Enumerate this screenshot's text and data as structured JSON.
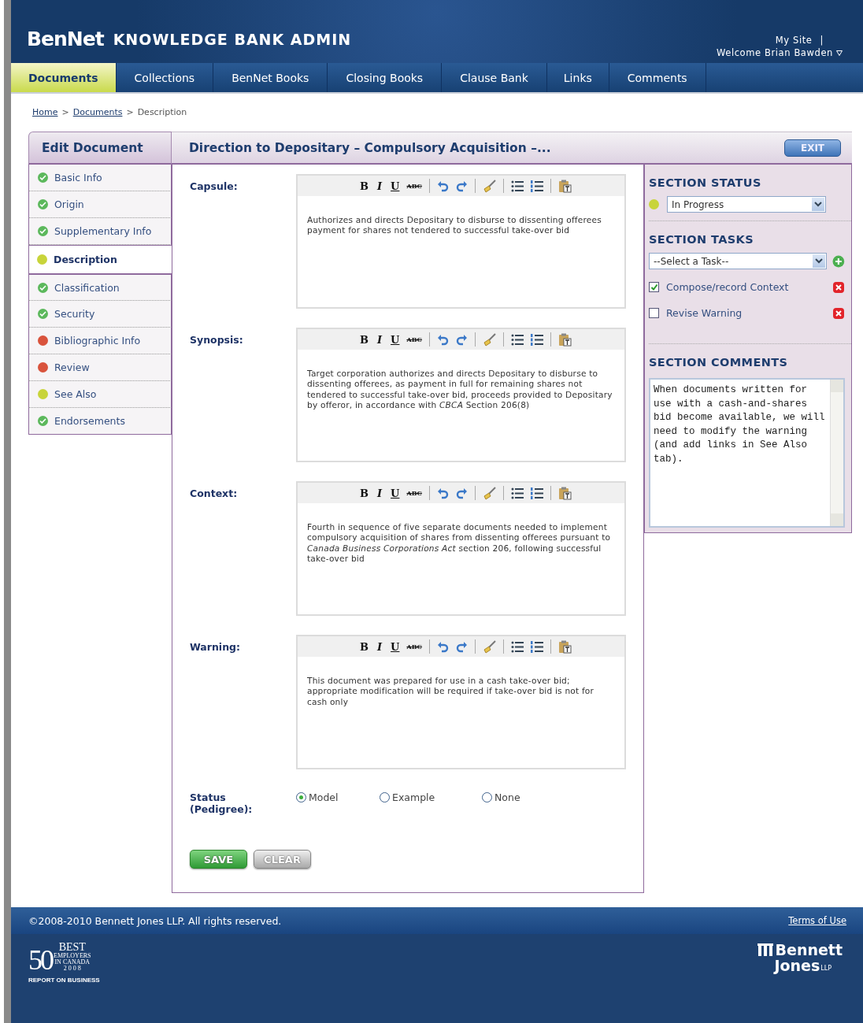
{
  "header": {
    "logo": "BenNet",
    "title": "KNOWLEDGE BANK ADMIN",
    "my_site": "My Site",
    "separator": "|",
    "welcome": "Welcome Brian Bawden"
  },
  "nav": [
    {
      "label": "Documents",
      "selected": true
    },
    {
      "label": "Collections",
      "selected": false
    },
    {
      "label": "BenNet Books",
      "selected": false
    },
    {
      "label": "Closing Books",
      "selected": false
    },
    {
      "label": "Clause Bank",
      "selected": false
    },
    {
      "label": "Links",
      "selected": false
    },
    {
      "label": "Comments",
      "selected": false
    }
  ],
  "breadcrumb": [
    {
      "label": "Home",
      "link": true
    },
    {
      "label": "Documents",
      "link": true
    },
    {
      "label": "Description",
      "link": false
    }
  ],
  "breadcrumb_separators": [
    ">",
    ">"
  ],
  "sidebar": {
    "title": "Edit Document",
    "items": [
      {
        "label": "Basic Info",
        "kind": "done",
        "color": "#5cb85c",
        "selected": false
      },
      {
        "label": "Origin",
        "kind": "done",
        "color": "#5cb85c",
        "selected": false
      },
      {
        "label": "Supplementary Info",
        "kind": "done",
        "color": "#5cb85c",
        "selected": false
      },
      {
        "label": "Description",
        "kind": "dot",
        "color": "#c8d43a",
        "selected": true
      },
      {
        "label": "Classification",
        "kind": "done",
        "color": "#5cb85c",
        "selected": false
      },
      {
        "label": "Security",
        "kind": "done",
        "color": "#5cb85c",
        "selected": false
      },
      {
        "label": "Bibliographic Info",
        "kind": "dot",
        "color": "#d9533c",
        "selected": false
      },
      {
        "label": "Review",
        "kind": "dot",
        "color": "#d9533c",
        "selected": false
      },
      {
        "label": "See Also",
        "kind": "dot",
        "color": "#c8d43a",
        "selected": false
      },
      {
        "label": "Endorsements",
        "kind": "done",
        "color": "#5cb85c",
        "selected": false
      }
    ]
  },
  "document": {
    "title": "Direction to Depositary – Compulsory Acquisition –...",
    "exit_button": "EXIT"
  },
  "fields": [
    {
      "label": "Capsule:",
      "toolbar": [
        "B",
        "I",
        "U",
        "ABC"
      ],
      "text": "Authorizes and directs Depositary to disburse to dissenting offerees payment for shares not tendered to successful take-over bid"
    },
    {
      "label": "Synopsis:",
      "toolbar": [
        "B",
        "I",
        "U",
        "ABC"
      ],
      "text": "Target corporation authorizes and directs Depositary to disburse to dissenting offerees, as payment in full for remaining shares not tendered to successful take-over bid, proceeds provided to Depositary by offeror, in accordance with *CBCA* Section 206(8)"
    },
    {
      "label": "Context:",
      "toolbar": [
        "B",
        "I",
        "U",
        "ABC"
      ],
      "text": "Fourth in sequence of five separate documents needed to implement compulsory acquisition of shares from dissenting offerees pursuant to *Canada Business Corporations Act* section 206, following successful take-over bid"
    },
    {
      "label": "Warning:",
      "toolbar": [
        "B",
        "I",
        "U",
        "ABC"
      ],
      "text": "This document was prepared for use in a cash take-over bid; appropriate modification will be required if take-over bid is not for cash only"
    }
  ],
  "pedigree": {
    "label_lines": [
      "Status",
      "(Pedigree):"
    ],
    "options": [
      {
        "label": "Model",
        "selected": true
      },
      {
        "label": "Example",
        "selected": false
      },
      {
        "label": "None",
        "selected": false
      }
    ]
  },
  "buttons": {
    "save": "SAVE",
    "clear": "CLEAR"
  },
  "section_status": {
    "heading": "SECTION STATUS",
    "kind": "dot",
    "color": "#c8d43a",
    "value": "In Progress"
  },
  "section_tasks": {
    "heading": "SECTION TASKS",
    "placeholder": "--Select a Task--",
    "items": [
      {
        "label": "Compose/record Context",
        "checked": true
      },
      {
        "label": "Revise Warning",
        "checked": false
      }
    ]
  },
  "section_comments": {
    "heading": "SECTION COMMENTS",
    "text": "When documents written for use with a cash-and-shares bid become available, we will need to modify the warning (and add links in See Also tab)."
  },
  "footer": {
    "copyright": "©2008-2010 Bennett Jones LLP. All rights reserved.",
    "terms": "Terms of Use",
    "award": {
      "number": "50",
      "best": "BEST",
      "lines": [
        "EMPLOYERS",
        "IN CANADA",
        "2 0 0 8"
      ],
      "publisher": "REPORT ON BUSINESS"
    },
    "brand": {
      "line1": "Bennett",
      "line2": "Jones",
      "suffix": "LLP"
    }
  }
}
